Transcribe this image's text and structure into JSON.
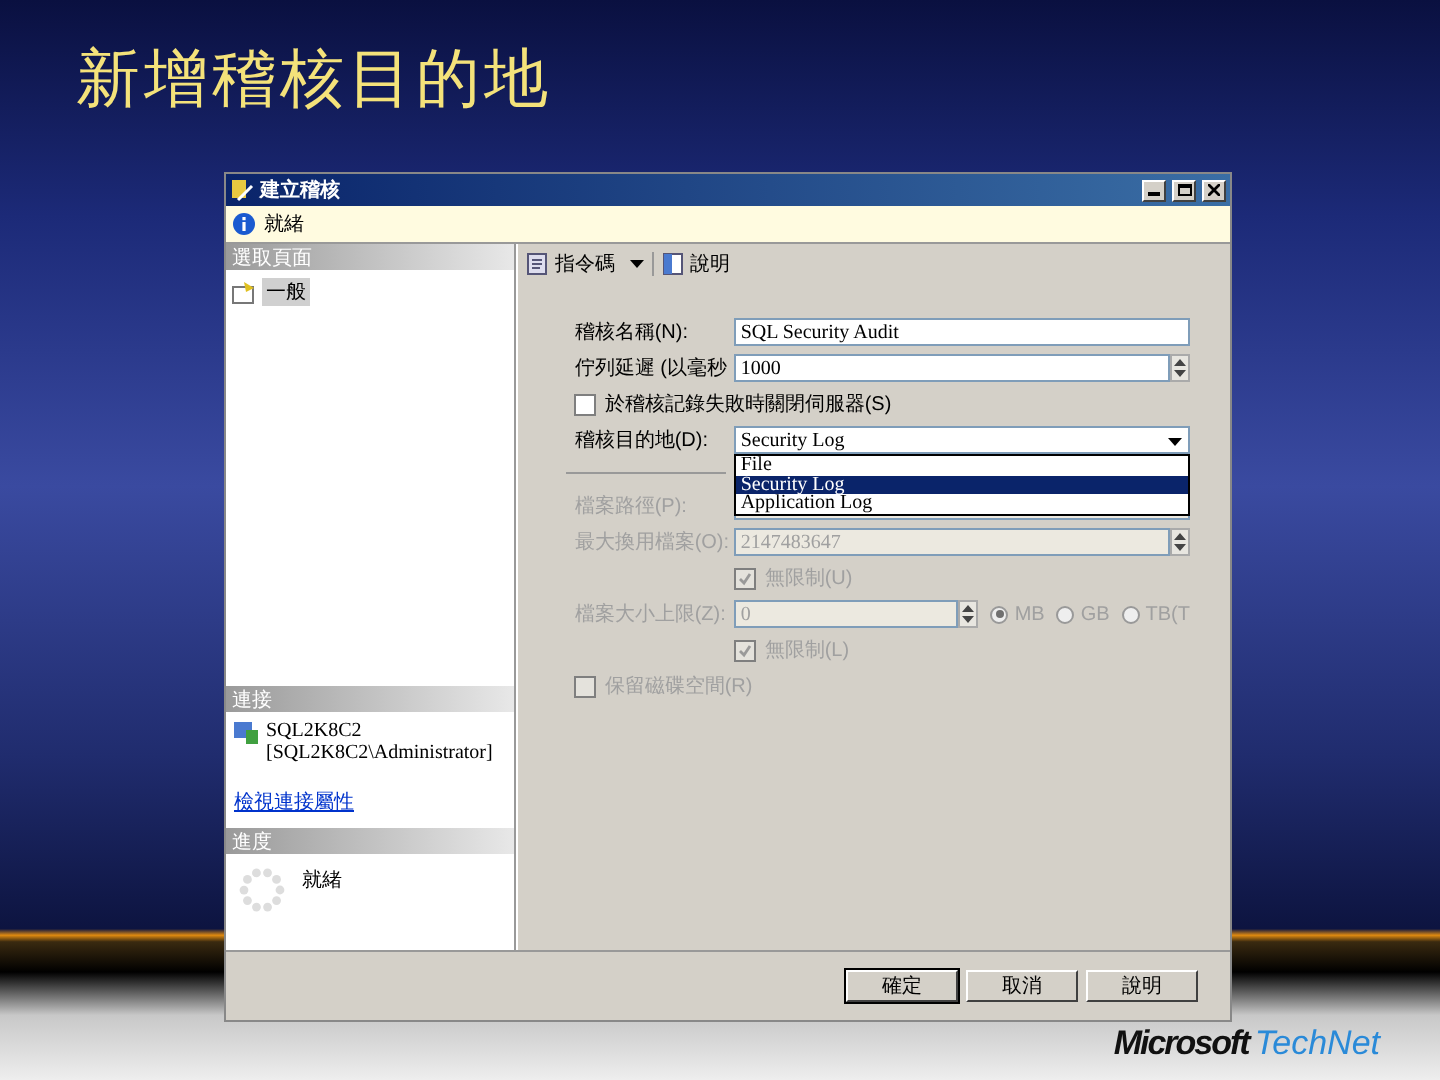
{
  "slide": {
    "title": "新增稽核目的地"
  },
  "dialog": {
    "title": "建立稽核",
    "status": "就緒",
    "select_page": {
      "header": "選取頁面",
      "items": [
        {
          "label": "一般",
          "selected": true
        }
      ]
    },
    "connection": {
      "header": "連接",
      "server": "SQL2K8C2",
      "user": "[SQL2K8C2\\Administrator]",
      "link": "檢視連接屬性"
    },
    "progress": {
      "header": "進度",
      "status": "就緒"
    },
    "toolbar": [
      {
        "label": "指令碼",
        "dropdown": true
      },
      {
        "label": "說明",
        "dropdown": false
      }
    ],
    "form": [
      {
        "kind": "text",
        "label": "稽核名稱(N):",
        "value": "SQL Security Audit",
        "disabled": false
      },
      {
        "kind": "spin",
        "label": "佇列延遲 (以毫秒",
        "value": "1000",
        "disabled": false
      },
      {
        "kind": "checkbox",
        "label": "於稽核記錄失敗時關閉伺服器(S)",
        "checked": false,
        "disabled": false
      },
      {
        "kind": "dropdown",
        "label": "稽核目的地(D):",
        "value": "Security Log",
        "expanded": true,
        "disabled": false,
        "options": [
          {
            "label": "File",
            "selected": false
          },
          {
            "label": "Security Log",
            "selected": true
          },
          {
            "label": "Application Log",
            "selected": false
          }
        ]
      },
      {
        "kind": "separator"
      },
      {
        "kind": "path",
        "label": "檔案路徑(P):",
        "disabled": true
      },
      {
        "kind": "spin",
        "label": "最大換用檔案(O):",
        "value": "2147483647",
        "disabled": true
      },
      {
        "kind": "subcheckbox",
        "label": "無限制(U)",
        "checked": true,
        "disabled": true
      },
      {
        "kind": "size",
        "label": "檔案大小上限(Z):",
        "value": "0",
        "disabled": true,
        "units": [
          {
            "label": "MB",
            "selected": true
          },
          {
            "label": "GB",
            "selected": false
          },
          {
            "label": "TB(T",
            "selected": false
          }
        ]
      },
      {
        "kind": "subcheckbox",
        "label": "無限制(L)",
        "checked": true,
        "disabled": true
      },
      {
        "kind": "checkbox",
        "label": "保留磁碟空間(R)",
        "checked": false,
        "disabled": true
      }
    ],
    "buttons": [
      {
        "label": "確定",
        "default": true
      },
      {
        "label": "取消",
        "default": false
      },
      {
        "label": "說明",
        "default": false
      }
    ]
  },
  "logo": {
    "brand": "Microsoft",
    "product": "TechNet"
  }
}
